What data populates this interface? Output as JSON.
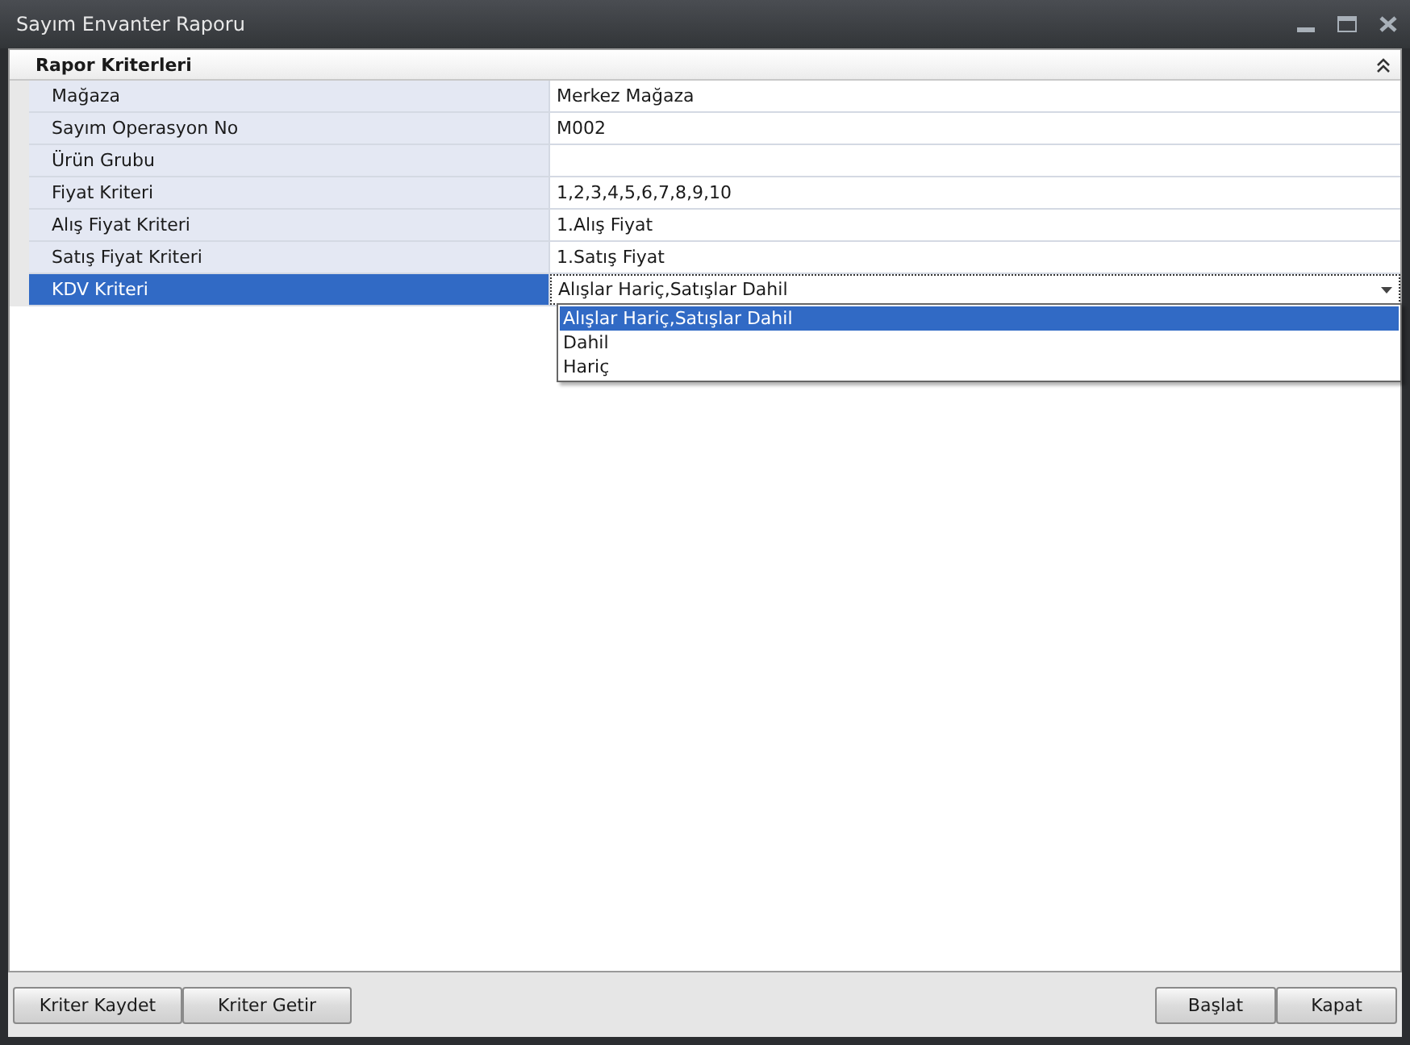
{
  "window": {
    "title": "Sayım Envanter Raporu"
  },
  "group": {
    "title": "Rapor Kriterleri",
    "expanded": true
  },
  "rows": [
    {
      "label": "Mağaza",
      "value": "Merkez Mağaza",
      "selected": false
    },
    {
      "label": "Sayım Operasyon No",
      "value": "M002",
      "selected": false
    },
    {
      "label": "Ürün Grubu",
      "selected": false
    },
    {
      "label": "Fiyat Kriteri",
      "value": "1,2,3,4,5,6,7,8,9,10",
      "selected": false
    },
    {
      "label": "Alış Fiyat Kriteri",
      "value": "1.Alış Fiyat",
      "selected": false
    },
    {
      "label": "Satış Fiyat Kriteri",
      "value": "1.Satış Fiyat",
      "selected": false
    },
    {
      "label": "KDV Kriteri",
      "value": "Alışlar Hariç,Satışlar Dahil",
      "selected": true,
      "kind": "dropdown"
    }
  ],
  "dropdown_options": [
    {
      "label": "Alışlar Hariç,Satışlar Dahil",
      "selected": true
    },
    {
      "label": "Dahil",
      "selected": false
    },
    {
      "label": "Hariç",
      "selected": false
    }
  ],
  "left_buttons": [
    "Kriter Kaydet",
    "Kriter Getir"
  ],
  "right_buttons": [
    "Başlat",
    "Kapat"
  ]
}
